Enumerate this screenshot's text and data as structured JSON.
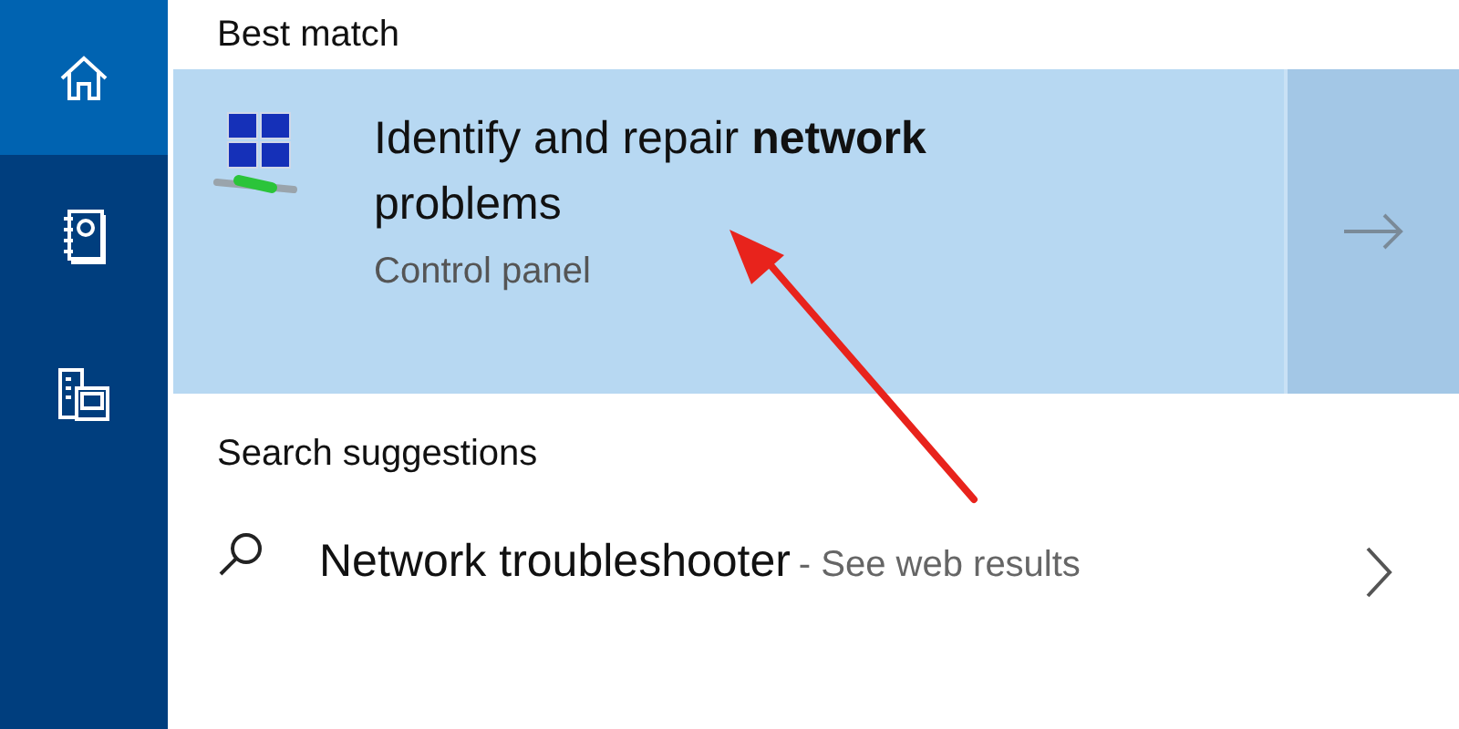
{
  "sidebar": {
    "items": [
      {
        "kind": "home",
        "selected": true
      },
      {
        "kind": "notebook",
        "selected": false
      },
      {
        "kind": "devices",
        "selected": false
      }
    ]
  },
  "best_match": {
    "heading": "Best match",
    "result": {
      "title": "Identify and repair **network** problems",
      "subtitle": "Control panel",
      "selected": true
    }
  },
  "suggestions": {
    "heading": "Search suggestions",
    "items": [
      {
        "text": "Network troubleshooter",
        "hint": "- See web results"
      }
    ]
  }
}
